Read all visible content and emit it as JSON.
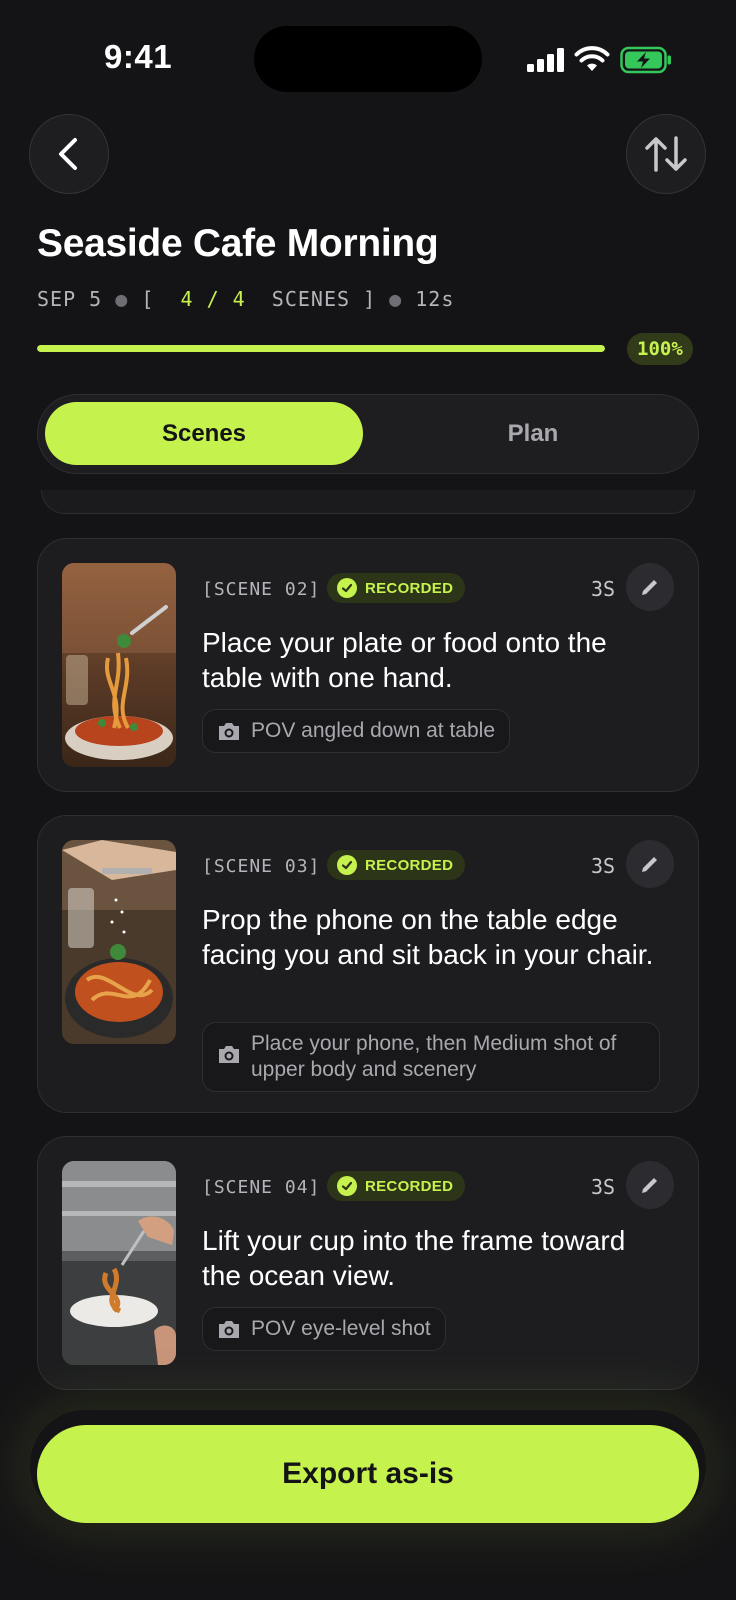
{
  "status_bar": {
    "time": "9:41"
  },
  "header": {
    "back_icon": "chevron-left-icon",
    "sort_icon": "swap-vertical-icon",
    "title": "Seaside Cafe Morning",
    "date": "SEP 5",
    "scenes_done": "4 / 4",
    "scenes_word": "SCENES",
    "duration": "12s",
    "progress": 1.0,
    "progress_label": "100%"
  },
  "tabs": {
    "active": "Scenes",
    "inactive": "Plan"
  },
  "scenes": [
    {
      "label": "[SCENE 02]",
      "status": "RECORDED",
      "duration": "3S",
      "instruction": "Place your plate or food onto the table with one hand.",
      "shot": "POV angled down at table"
    },
    {
      "label": "[SCENE 03]",
      "status": "RECORDED",
      "duration": "3S",
      "instruction": "Prop the phone on the table edge facing you and sit back in your chair.",
      "shot": "Place your phone, then Medium shot of upper body and scenery"
    },
    {
      "label": "[SCENE 04]",
      "status": "RECORDED",
      "duration": "3S",
      "instruction": "Lift your cup into the frame toward the ocean view.",
      "shot": "POV eye-level shot"
    }
  ],
  "export": {
    "label": "Export as-is"
  },
  "colors": {
    "accent": "#c6f24e",
    "background": "#141416",
    "card": "#1d1d20"
  }
}
